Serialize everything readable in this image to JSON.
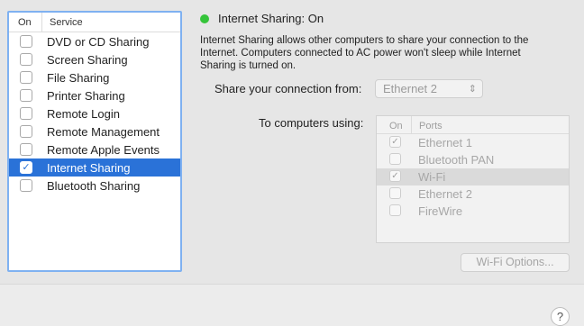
{
  "services": {
    "header_on": "On",
    "header_service": "Service",
    "items": [
      {
        "label": "DVD or CD Sharing",
        "checked": false
      },
      {
        "label": "Screen Sharing",
        "checked": false
      },
      {
        "label": "File Sharing",
        "checked": false
      },
      {
        "label": "Printer Sharing",
        "checked": false
      },
      {
        "label": "Remote Login",
        "checked": false
      },
      {
        "label": "Remote Management",
        "checked": false
      },
      {
        "label": "Remote Apple Events",
        "checked": false
      },
      {
        "label": "Internet Sharing",
        "checked": true,
        "selected": true
      },
      {
        "label": "Bluetooth Sharing",
        "checked": false
      }
    ]
  },
  "status": {
    "title": "Internet Sharing: On",
    "color": "#35c43a",
    "description": "Internet Sharing allows other computers to share your connection to the Internet. Computers connected to AC power won't sleep while Internet Sharing is turned on."
  },
  "share_from": {
    "label": "Share your connection from:",
    "value": "Ethernet 2"
  },
  "computers_using": {
    "label": "To computers using:",
    "header_on": "On",
    "header_ports": "Ports",
    "ports": [
      {
        "label": "Ethernet 1",
        "checked": true
      },
      {
        "label": "Bluetooth PAN",
        "checked": false
      },
      {
        "label": "Wi-Fi",
        "checked": true,
        "selected": true
      },
      {
        "label": "Ethernet 2",
        "checked": false
      },
      {
        "label": "FireWire",
        "checked": false
      }
    ]
  },
  "wifi_options_label": "Wi-Fi Options...",
  "help_label": "?",
  "check_glyph": "✓"
}
